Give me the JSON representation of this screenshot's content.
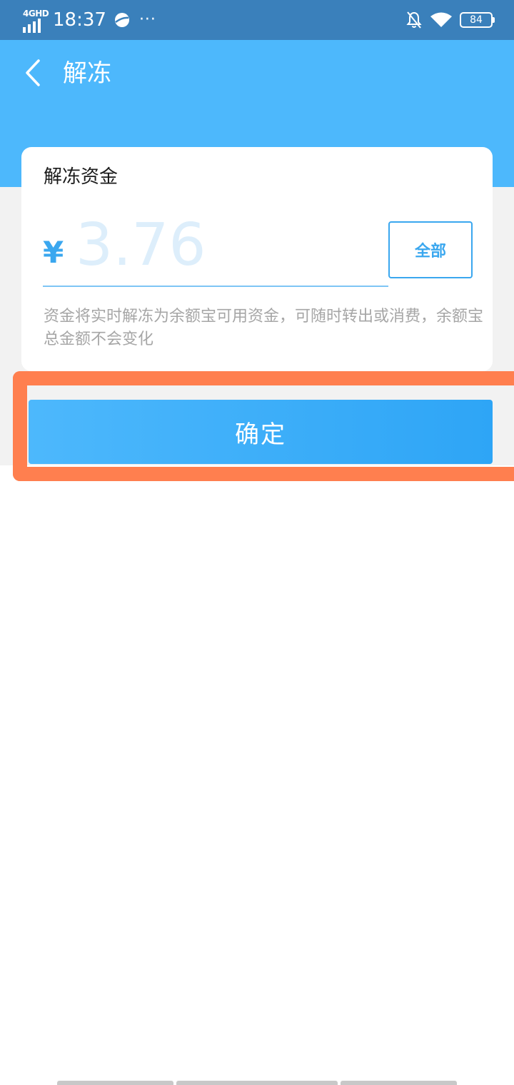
{
  "status_bar": {
    "network": "4GHD",
    "time": "18:37",
    "dots": "···",
    "battery": "84",
    "icons": [
      "signal-icon",
      "browser-app-icon",
      "bell-off-icon",
      "wifi-icon",
      "battery-icon"
    ]
  },
  "header": {
    "back_icon": "chevron-left-icon",
    "title": "解冻"
  },
  "card": {
    "title": "解冻资金",
    "currency": "¥",
    "amount_placeholder": "3.76",
    "all_label": "全部",
    "hint": "资金将实时解冻为余额宝可用资金，可随时转出或消费，余额宝总金额不会变化"
  },
  "actions": {
    "confirm_label": "确定"
  },
  "colors": {
    "status_bar": "#3a80bb",
    "header": "#4db8fc",
    "accent": "#3aa7ef",
    "highlight": "#ff7f4f",
    "hint_text": "#a6a6a6"
  }
}
